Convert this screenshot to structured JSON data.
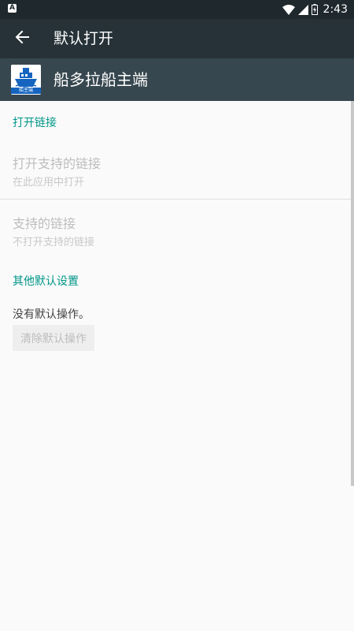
{
  "status_bar": {
    "left_icon": "A",
    "time": "2:43",
    "icons": [
      "wifi-icon",
      "signal-icon",
      "battery-icon"
    ]
  },
  "toolbar": {
    "title": "默认打开",
    "back_icon": "arrow-left-icon"
  },
  "app": {
    "name": "船多拉船主端",
    "icon_label": "船主端"
  },
  "sections": {
    "open_links": {
      "header": "打开链接",
      "open_supported": {
        "title": "打开支持的链接",
        "summary": "在此应用中打开"
      },
      "supported_links": {
        "title": "支持的链接",
        "summary": "不打开支持的链接"
      }
    },
    "other_defaults": {
      "header": "其他默认设置",
      "no_default_text": "没有默认操作。",
      "clear_button": "清除默认操作"
    }
  },
  "colors": {
    "status_bar": "#1e282d",
    "toolbar": "#263238",
    "app_header": "#37474f",
    "accent": "#009688",
    "background": "#fafafa"
  }
}
